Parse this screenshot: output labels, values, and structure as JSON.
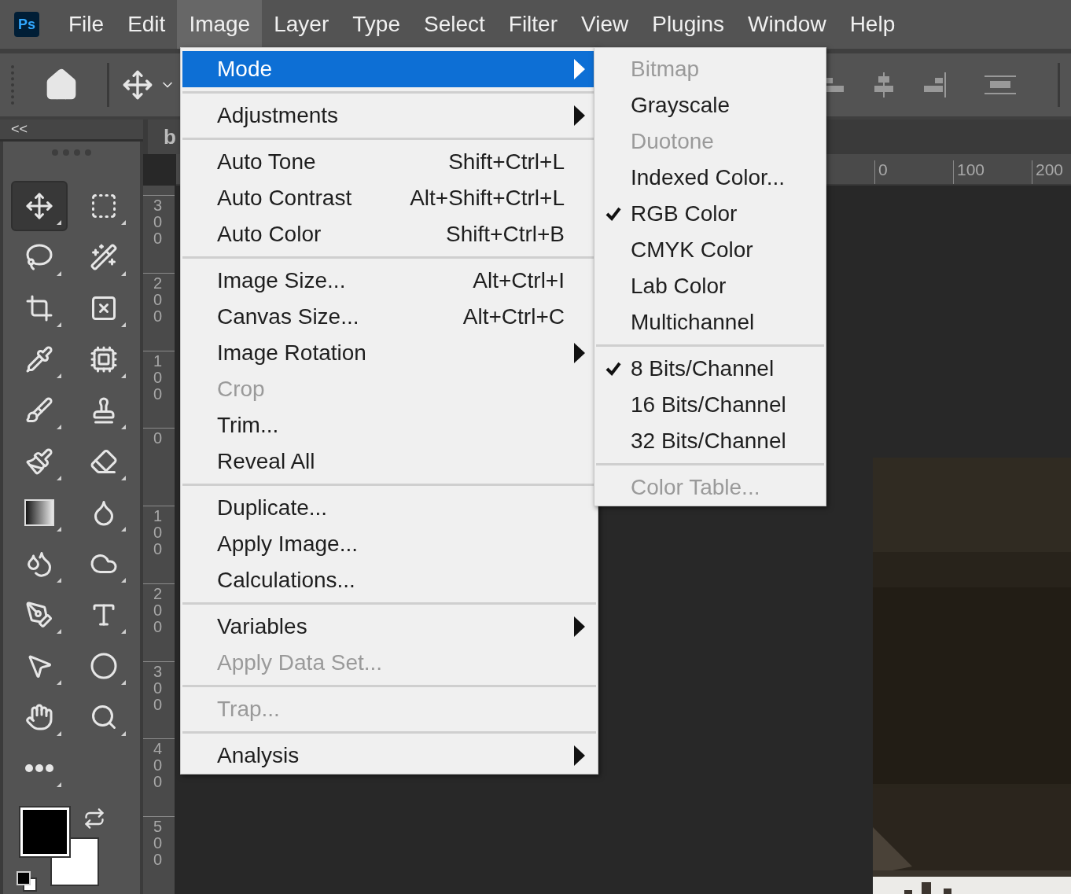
{
  "app_logo": "Ps",
  "menu_bar": [
    {
      "label": "File",
      "selected": false
    },
    {
      "label": "Edit",
      "selected": false
    },
    {
      "label": "Image",
      "selected": true
    },
    {
      "label": "Layer",
      "selected": false
    },
    {
      "label": "Type",
      "selected": false
    },
    {
      "label": "Select",
      "selected": false
    },
    {
      "label": "Filter",
      "selected": false
    },
    {
      "label": "View",
      "selected": false
    },
    {
      "label": "Plugins",
      "selected": false
    },
    {
      "label": "Window",
      "selected": false
    },
    {
      "label": "Help",
      "selected": false
    }
  ],
  "panel_toggle": "<<",
  "tools": [
    {
      "selected": true
    },
    {
      "selected": false
    },
    {
      "selected": false
    },
    {
      "selected": false
    },
    {
      "selected": false
    },
    {
      "selected": false
    },
    {
      "selected": false
    },
    {
      "selected": false
    },
    {
      "selected": false
    },
    {
      "selected": false
    },
    {
      "selected": false
    },
    {
      "selected": false
    },
    {
      "selected": false
    },
    {
      "selected": false
    },
    {
      "selected": false
    },
    {
      "selected": false
    },
    {
      "selected": false
    },
    {
      "selected": false
    },
    {
      "selected": false
    },
    {
      "selected": false
    },
    {
      "selected": false
    },
    {
      "selected": false
    },
    {
      "selected": false
    }
  ],
  "document_tab": "b",
  "horizontal_ruler": [
    "0",
    "100",
    "200"
  ],
  "vertical_ruler": [
    "300",
    "200",
    "100",
    "0",
    "100",
    "200",
    "300",
    "400",
    "500"
  ],
  "image_menu": [
    {
      "kind": "item",
      "label": "Mode",
      "submenu": true,
      "disabled": false,
      "selected": true
    },
    {
      "kind": "separator"
    },
    {
      "kind": "item",
      "label": "Adjustments",
      "submenu": true,
      "disabled": false,
      "selected": false
    },
    {
      "kind": "separator"
    },
    {
      "kind": "item",
      "label": "Auto Tone",
      "shortcut": "Shift+Ctrl+L",
      "disabled": false,
      "selected": false
    },
    {
      "kind": "item",
      "label": "Auto Contrast",
      "shortcut": "Alt+Shift+Ctrl+L",
      "disabled": false,
      "selected": false
    },
    {
      "kind": "item",
      "label": "Auto Color",
      "shortcut": "Shift+Ctrl+B",
      "disabled": false,
      "selected": false
    },
    {
      "kind": "separator"
    },
    {
      "kind": "item",
      "label": "Image Size...",
      "shortcut": "Alt+Ctrl+I",
      "disabled": false,
      "selected": false
    },
    {
      "kind": "item",
      "label": "Canvas Size...",
      "shortcut": "Alt+Ctrl+C",
      "disabled": false,
      "selected": false
    },
    {
      "kind": "item",
      "label": "Image Rotation",
      "submenu": true,
      "disabled": false,
      "selected": false
    },
    {
      "kind": "item",
      "label": "Crop",
      "disabled": true,
      "selected": false
    },
    {
      "kind": "item",
      "label": "Trim...",
      "disabled": false,
      "selected": false
    },
    {
      "kind": "item",
      "label": "Reveal All",
      "disabled": false,
      "selected": false
    },
    {
      "kind": "separator"
    },
    {
      "kind": "item",
      "label": "Duplicate...",
      "disabled": false,
      "selected": false
    },
    {
      "kind": "item",
      "label": "Apply Image...",
      "disabled": false,
      "selected": false
    },
    {
      "kind": "item",
      "label": "Calculations...",
      "disabled": false,
      "selected": false
    },
    {
      "kind": "separator"
    },
    {
      "kind": "item",
      "label": "Variables",
      "submenu": true,
      "disabled": false,
      "selected": false
    },
    {
      "kind": "item",
      "label": "Apply Data Set...",
      "disabled": true,
      "selected": false
    },
    {
      "kind": "separator"
    },
    {
      "kind": "item",
      "label": "Trap...",
      "disabled": true,
      "selected": false
    },
    {
      "kind": "separator"
    },
    {
      "kind": "item",
      "label": "Analysis",
      "submenu": true,
      "disabled": false,
      "selected": false
    }
  ],
  "mode_submenu": [
    {
      "kind": "item",
      "label": "Bitmap",
      "checked": false,
      "disabled": true
    },
    {
      "kind": "item",
      "label": "Grayscale",
      "checked": false,
      "disabled": false
    },
    {
      "kind": "item",
      "label": "Duotone",
      "checked": false,
      "disabled": true
    },
    {
      "kind": "item",
      "label": "Indexed Color...",
      "checked": false,
      "disabled": false
    },
    {
      "kind": "item",
      "label": "RGB Color",
      "checked": true,
      "disabled": false
    },
    {
      "kind": "item",
      "label": "CMYK Color",
      "checked": false,
      "disabled": false
    },
    {
      "kind": "item",
      "label": "Lab Color",
      "checked": false,
      "disabled": false
    },
    {
      "kind": "item",
      "label": "Multichannel",
      "checked": false,
      "disabled": false
    },
    {
      "kind": "separator"
    },
    {
      "kind": "item",
      "label": "8 Bits/Channel",
      "checked": true,
      "disabled": false
    },
    {
      "kind": "item",
      "label": "16 Bits/Channel",
      "checked": false,
      "disabled": false
    },
    {
      "kind": "item",
      "label": "32 Bits/Channel",
      "checked": false,
      "disabled": false
    },
    {
      "kind": "separator"
    },
    {
      "kind": "item",
      "label": "Color Table...",
      "checked": false,
      "disabled": true
    }
  ]
}
